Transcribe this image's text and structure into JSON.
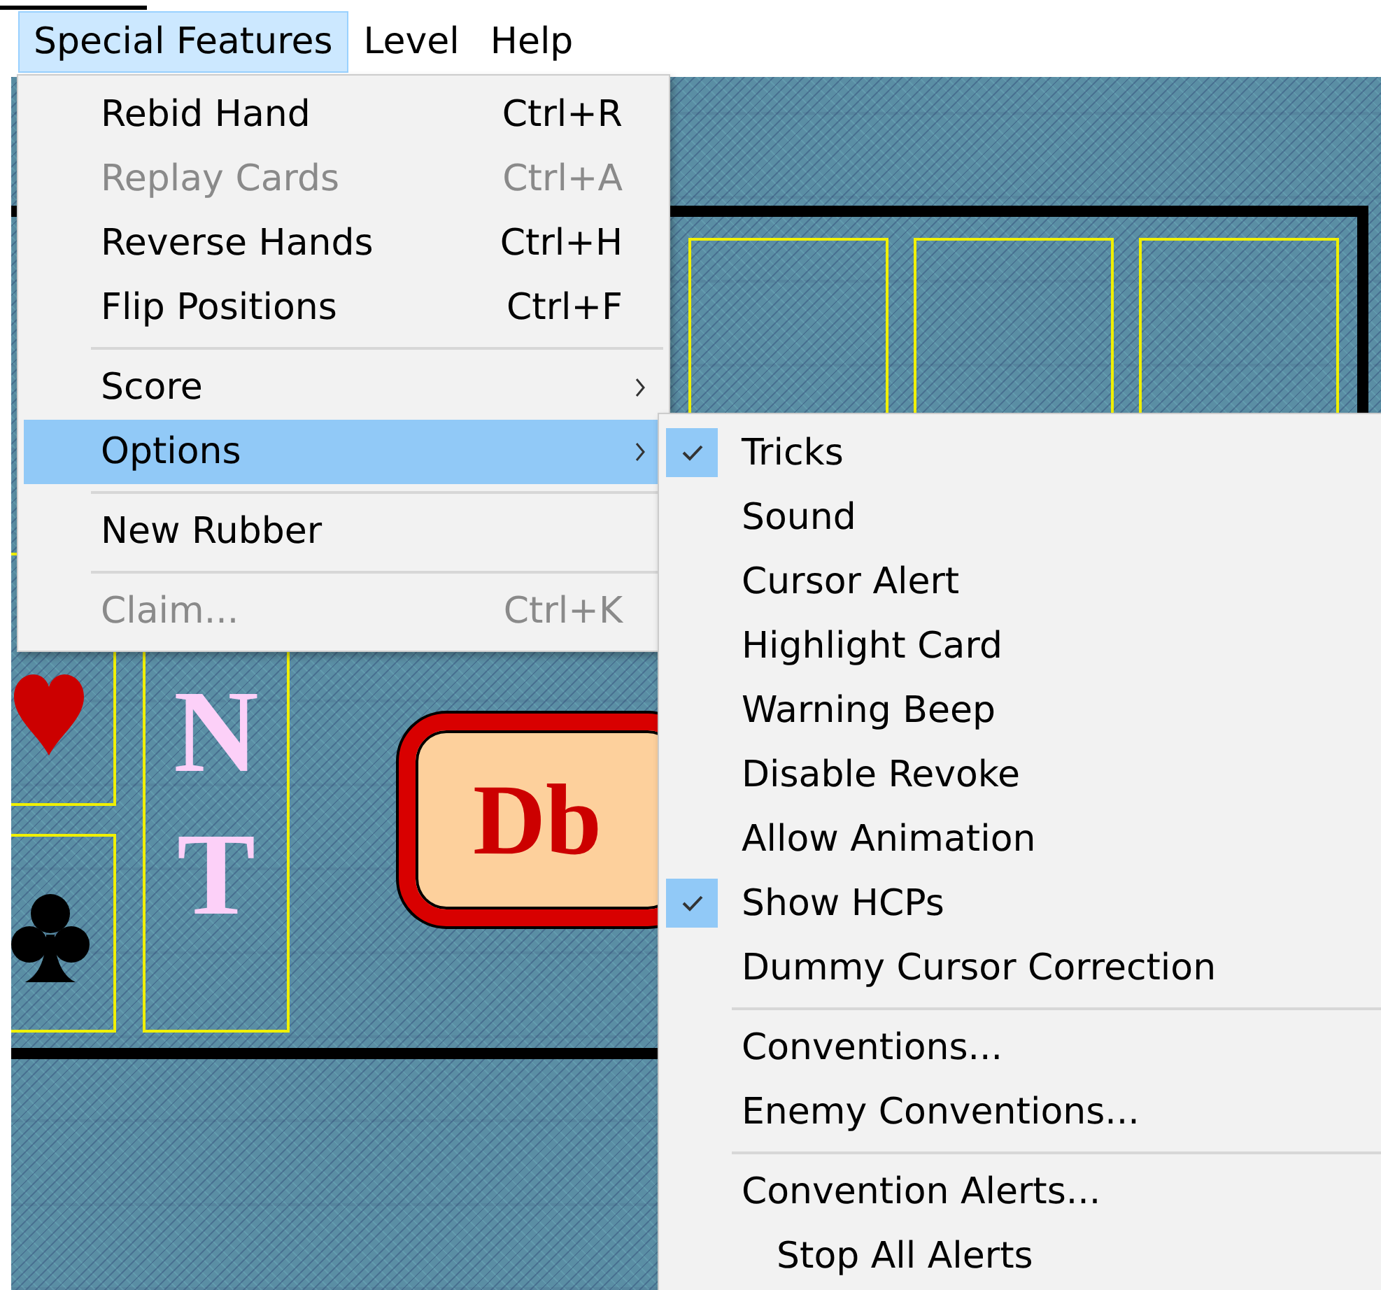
{
  "menubar": [
    {
      "label": "Special Features",
      "selected": true
    },
    {
      "label": "Level",
      "selected": false
    },
    {
      "label": "Help",
      "selected": false
    }
  ],
  "menu": [
    {
      "kind": "item",
      "label": "Rebid Hand",
      "shortcut": "Ctrl+R",
      "disabled": false,
      "submenu": false,
      "selected": false
    },
    {
      "kind": "item",
      "label": "Replay Cards",
      "shortcut": "Ctrl+A",
      "disabled": true,
      "submenu": false,
      "selected": false
    },
    {
      "kind": "item",
      "label": "Reverse Hands",
      "shortcut": "Ctrl+H",
      "disabled": false,
      "submenu": false,
      "selected": false
    },
    {
      "kind": "item",
      "label": "Flip Positions",
      "shortcut": "Ctrl+F",
      "disabled": false,
      "submenu": false,
      "selected": false
    },
    {
      "kind": "separator"
    },
    {
      "kind": "item",
      "label": "Score",
      "disabled": false,
      "submenu": true,
      "selected": false
    },
    {
      "kind": "item",
      "label": "Options",
      "disabled": false,
      "submenu": true,
      "selected": true
    },
    {
      "kind": "separator"
    },
    {
      "kind": "item",
      "label": "New Rubber",
      "disabled": false,
      "submenu": false,
      "selected": false
    },
    {
      "kind": "separator"
    },
    {
      "kind": "item",
      "label": "Claim...",
      "shortcut": "Ctrl+K",
      "disabled": true,
      "submenu": false,
      "selected": false
    }
  ],
  "options_submenu": [
    {
      "kind": "item",
      "label": "Tricks",
      "checked": true
    },
    {
      "kind": "item",
      "label": "Sound",
      "checked": false
    },
    {
      "kind": "item",
      "label": "Cursor Alert",
      "checked": false
    },
    {
      "kind": "item",
      "label": "Highlight Card",
      "checked": false
    },
    {
      "kind": "item",
      "label": "Warning Beep",
      "checked": false
    },
    {
      "kind": "item",
      "label": "Disable Revoke",
      "checked": false
    },
    {
      "kind": "item",
      "label": "Allow Animation",
      "checked": false
    },
    {
      "kind": "item",
      "label": "Show HCPs",
      "checked": true
    },
    {
      "kind": "item",
      "label": "Dummy Cursor Correction",
      "checked": false
    },
    {
      "kind": "separator"
    },
    {
      "kind": "item",
      "label": "Conventions...",
      "checked": false
    },
    {
      "kind": "item",
      "label": "Enemy Conventions...",
      "checked": false
    },
    {
      "kind": "separator"
    },
    {
      "kind": "item",
      "label": "Convention Alerts...",
      "checked": false
    },
    {
      "kind": "item",
      "label": "Stop All Alerts",
      "checked": false,
      "indented": true
    }
  ],
  "board": {
    "cards": [
      {
        "kind": "plain"
      },
      {
        "kind": "plain"
      },
      {
        "kind": "plain"
      },
      {
        "kind": "heart"
      },
      {
        "kind": "club"
      },
      {
        "kind": "strain",
        "letters": [
          "N",
          "T"
        ]
      }
    ],
    "double_button": {
      "label": "Db"
    }
  }
}
